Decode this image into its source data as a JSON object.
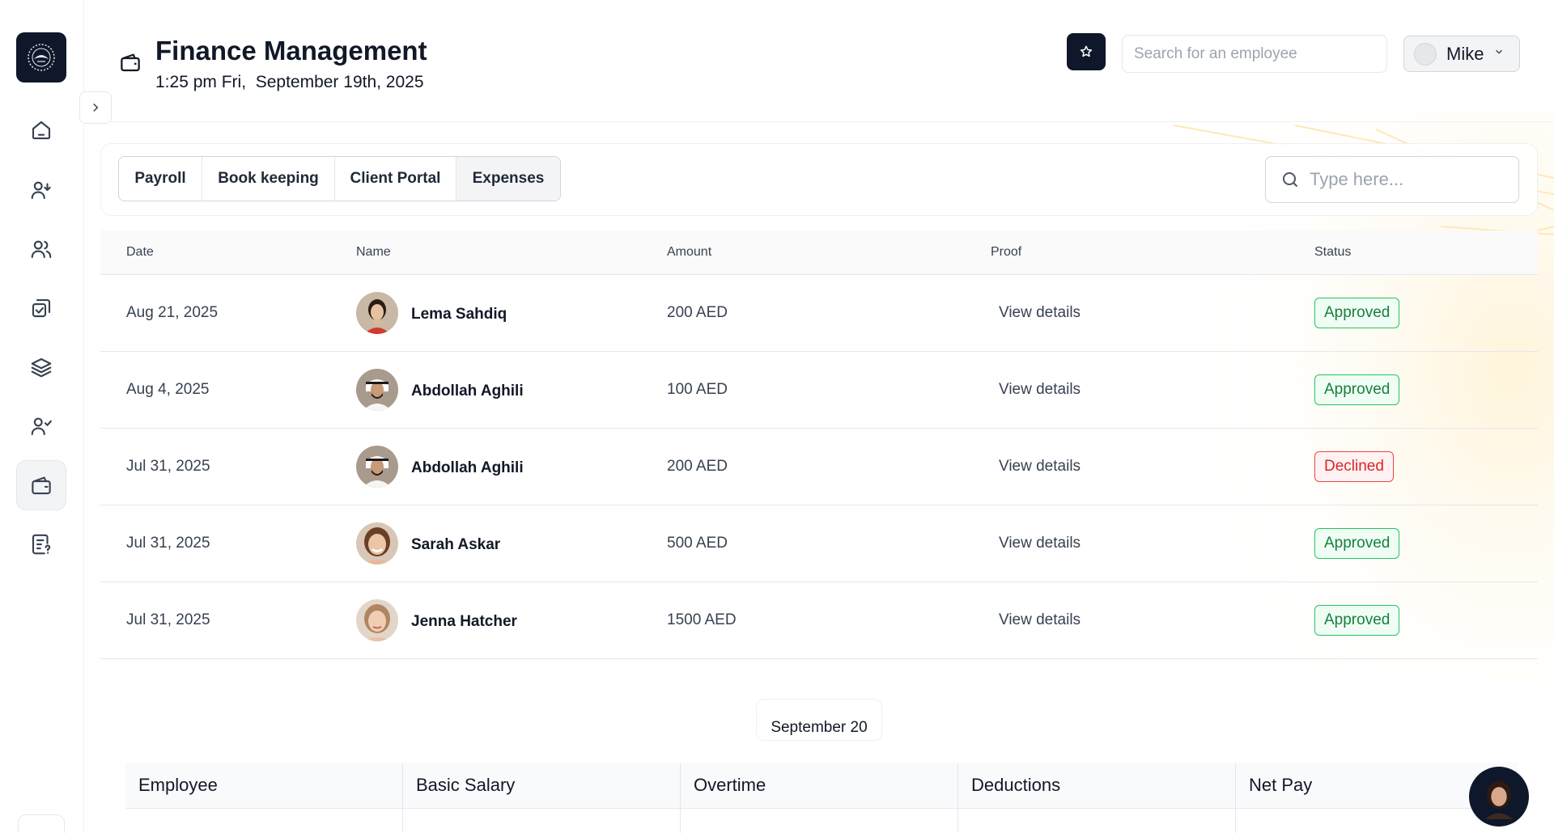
{
  "header": {
    "title": "Finance Management",
    "datetime": "1:25 pm Fri,  September 19th, 2025",
    "employee_search_placeholder": "Search for an employee",
    "user_name": "Mike"
  },
  "sidebar": {
    "items": [
      {
        "icon": "home-icon"
      },
      {
        "icon": "user-add-icon"
      },
      {
        "icon": "users-icon"
      },
      {
        "icon": "tasks-icon"
      },
      {
        "icon": "layers-icon"
      },
      {
        "icon": "user-check-icon"
      },
      {
        "icon": "wallet-icon",
        "active": true
      },
      {
        "icon": "report-icon"
      }
    ]
  },
  "tabs": [
    {
      "label": "Payroll",
      "active": false
    },
    {
      "label": "Book keeping",
      "active": false
    },
    {
      "label": "Client Portal",
      "active": false
    },
    {
      "label": "Expenses",
      "active": true
    }
  ],
  "table_search_placeholder": "Type here...",
  "expenses": {
    "columns": [
      "Date",
      "Name",
      "Amount",
      "Proof",
      "Status"
    ],
    "rows": [
      {
        "date": "Aug 21, 2025",
        "name": "Lema Sahdiq",
        "amount": "200 AED",
        "proof": "View details",
        "status": "Approved"
      },
      {
        "date": "Aug 4, 2025",
        "name": "Abdollah Aghili",
        "amount": "100 AED",
        "proof": "View details",
        "status": "Approved"
      },
      {
        "date": "Jul 31, 2025",
        "name": "Abdollah Aghili",
        "amount": "200 AED",
        "proof": "View details",
        "status": "Declined"
      },
      {
        "date": "Jul 31, 2025",
        "name": "Sarah Askar",
        "amount": "500 AED",
        "proof": "View details",
        "status": "Approved"
      },
      {
        "date": "Jul 31, 2025",
        "name": "Jenna Hatcher",
        "amount": "1500 AED",
        "proof": "View details",
        "status": "Approved"
      }
    ]
  },
  "month_label": "September 20",
  "payroll": {
    "columns": [
      "Employee",
      "Basic Salary",
      "Overtime",
      "Deductions",
      "Net Pay"
    ]
  },
  "colors": {
    "approved": "#15803d",
    "declined": "#dc2626",
    "dark": "#0f172a"
  }
}
